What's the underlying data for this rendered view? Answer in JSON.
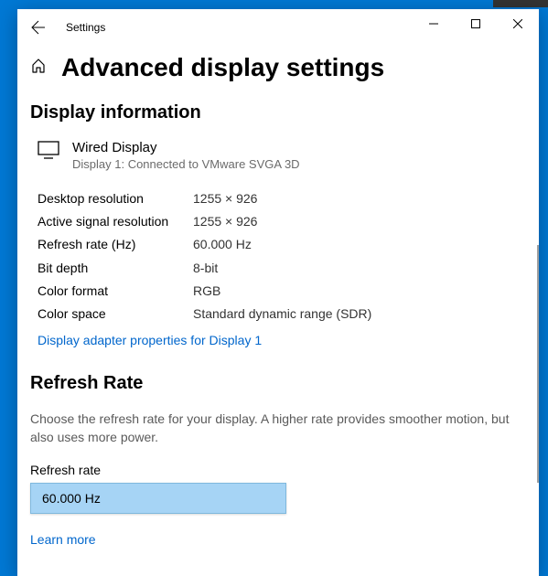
{
  "titlebar": {
    "title": "Settings"
  },
  "page": {
    "heading": "Advanced display settings"
  },
  "displayInfo": {
    "heading": "Display information",
    "name": "Wired Display",
    "sub": "Display 1: Connected to VMware SVGA 3D",
    "rows": [
      {
        "label": "Desktop resolution",
        "value": "1255 × 926"
      },
      {
        "label": "Active signal resolution",
        "value": "1255 × 926"
      },
      {
        "label": "Refresh rate (Hz)",
        "value": "60.000 Hz"
      },
      {
        "label": "Bit depth",
        "value": "8-bit"
      },
      {
        "label": "Color format",
        "value": "RGB"
      },
      {
        "label": "Color space",
        "value": "Standard dynamic range (SDR)"
      }
    ],
    "adapterLink": "Display adapter properties for Display 1"
  },
  "refreshRate": {
    "heading": "Refresh Rate",
    "desc": "Choose the refresh rate for your display. A higher rate provides smoother motion, but also uses more power.",
    "fieldLabel": "Refresh rate",
    "selected": "60.000 Hz",
    "learnMore": "Learn more"
  }
}
